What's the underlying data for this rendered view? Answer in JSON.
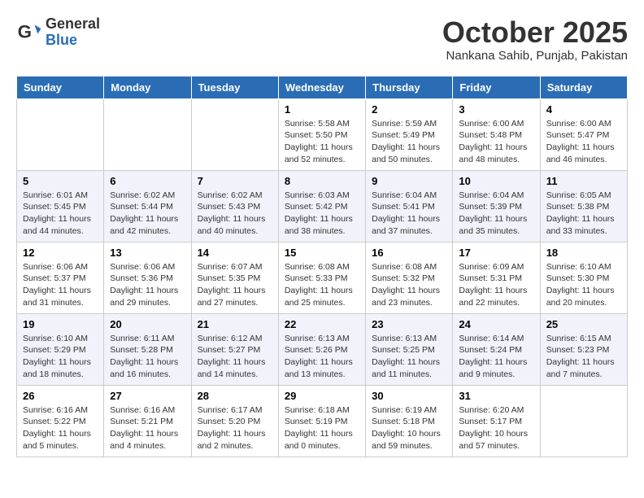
{
  "logo": {
    "general": "General",
    "blue": "Blue"
  },
  "title": "October 2025",
  "location": "Nankana Sahib, Punjab, Pakistan",
  "weekdays": [
    "Sunday",
    "Monday",
    "Tuesday",
    "Wednesday",
    "Thursday",
    "Friday",
    "Saturday"
  ],
  "weeks": [
    [
      {
        "day": "",
        "info": ""
      },
      {
        "day": "",
        "info": ""
      },
      {
        "day": "",
        "info": ""
      },
      {
        "day": "1",
        "info": "Sunrise: 5:58 AM\nSunset: 5:50 PM\nDaylight: 11 hours and 52 minutes."
      },
      {
        "day": "2",
        "info": "Sunrise: 5:59 AM\nSunset: 5:49 PM\nDaylight: 11 hours and 50 minutes."
      },
      {
        "day": "3",
        "info": "Sunrise: 6:00 AM\nSunset: 5:48 PM\nDaylight: 11 hours and 48 minutes."
      },
      {
        "day": "4",
        "info": "Sunrise: 6:00 AM\nSunset: 5:47 PM\nDaylight: 11 hours and 46 minutes."
      }
    ],
    [
      {
        "day": "5",
        "info": "Sunrise: 6:01 AM\nSunset: 5:45 PM\nDaylight: 11 hours and 44 minutes."
      },
      {
        "day": "6",
        "info": "Sunrise: 6:02 AM\nSunset: 5:44 PM\nDaylight: 11 hours and 42 minutes."
      },
      {
        "day": "7",
        "info": "Sunrise: 6:02 AM\nSunset: 5:43 PM\nDaylight: 11 hours and 40 minutes."
      },
      {
        "day": "8",
        "info": "Sunrise: 6:03 AM\nSunset: 5:42 PM\nDaylight: 11 hours and 38 minutes."
      },
      {
        "day": "9",
        "info": "Sunrise: 6:04 AM\nSunset: 5:41 PM\nDaylight: 11 hours and 37 minutes."
      },
      {
        "day": "10",
        "info": "Sunrise: 6:04 AM\nSunset: 5:39 PM\nDaylight: 11 hours and 35 minutes."
      },
      {
        "day": "11",
        "info": "Sunrise: 6:05 AM\nSunset: 5:38 PM\nDaylight: 11 hours and 33 minutes."
      }
    ],
    [
      {
        "day": "12",
        "info": "Sunrise: 6:06 AM\nSunset: 5:37 PM\nDaylight: 11 hours and 31 minutes."
      },
      {
        "day": "13",
        "info": "Sunrise: 6:06 AM\nSunset: 5:36 PM\nDaylight: 11 hours and 29 minutes."
      },
      {
        "day": "14",
        "info": "Sunrise: 6:07 AM\nSunset: 5:35 PM\nDaylight: 11 hours and 27 minutes."
      },
      {
        "day": "15",
        "info": "Sunrise: 6:08 AM\nSunset: 5:33 PM\nDaylight: 11 hours and 25 minutes."
      },
      {
        "day": "16",
        "info": "Sunrise: 6:08 AM\nSunset: 5:32 PM\nDaylight: 11 hours and 23 minutes."
      },
      {
        "day": "17",
        "info": "Sunrise: 6:09 AM\nSunset: 5:31 PM\nDaylight: 11 hours and 22 minutes."
      },
      {
        "day": "18",
        "info": "Sunrise: 6:10 AM\nSunset: 5:30 PM\nDaylight: 11 hours and 20 minutes."
      }
    ],
    [
      {
        "day": "19",
        "info": "Sunrise: 6:10 AM\nSunset: 5:29 PM\nDaylight: 11 hours and 18 minutes."
      },
      {
        "day": "20",
        "info": "Sunrise: 6:11 AM\nSunset: 5:28 PM\nDaylight: 11 hours and 16 minutes."
      },
      {
        "day": "21",
        "info": "Sunrise: 6:12 AM\nSunset: 5:27 PM\nDaylight: 11 hours and 14 minutes."
      },
      {
        "day": "22",
        "info": "Sunrise: 6:13 AM\nSunset: 5:26 PM\nDaylight: 11 hours and 13 minutes."
      },
      {
        "day": "23",
        "info": "Sunrise: 6:13 AM\nSunset: 5:25 PM\nDaylight: 11 hours and 11 minutes."
      },
      {
        "day": "24",
        "info": "Sunrise: 6:14 AM\nSunset: 5:24 PM\nDaylight: 11 hours and 9 minutes."
      },
      {
        "day": "25",
        "info": "Sunrise: 6:15 AM\nSunset: 5:23 PM\nDaylight: 11 hours and 7 minutes."
      }
    ],
    [
      {
        "day": "26",
        "info": "Sunrise: 6:16 AM\nSunset: 5:22 PM\nDaylight: 11 hours and 5 minutes."
      },
      {
        "day": "27",
        "info": "Sunrise: 6:16 AM\nSunset: 5:21 PM\nDaylight: 11 hours and 4 minutes."
      },
      {
        "day": "28",
        "info": "Sunrise: 6:17 AM\nSunset: 5:20 PM\nDaylight: 11 hours and 2 minutes."
      },
      {
        "day": "29",
        "info": "Sunrise: 6:18 AM\nSunset: 5:19 PM\nDaylight: 11 hours and 0 minutes."
      },
      {
        "day": "30",
        "info": "Sunrise: 6:19 AM\nSunset: 5:18 PM\nDaylight: 10 hours and 59 minutes."
      },
      {
        "day": "31",
        "info": "Sunrise: 6:20 AM\nSunset: 5:17 PM\nDaylight: 10 hours and 57 minutes."
      },
      {
        "day": "",
        "info": ""
      }
    ]
  ]
}
